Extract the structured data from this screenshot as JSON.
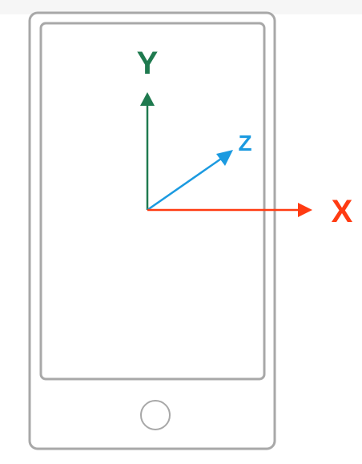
{
  "axes": {
    "y": {
      "label": "Y",
      "color": "#1f7a4f"
    },
    "z": {
      "label": "Z",
      "color": "#1b9ae0"
    },
    "x": {
      "label": "X",
      "color": "#ff3b12"
    }
  },
  "device": {
    "frame_color": "#a8a8a8"
  }
}
